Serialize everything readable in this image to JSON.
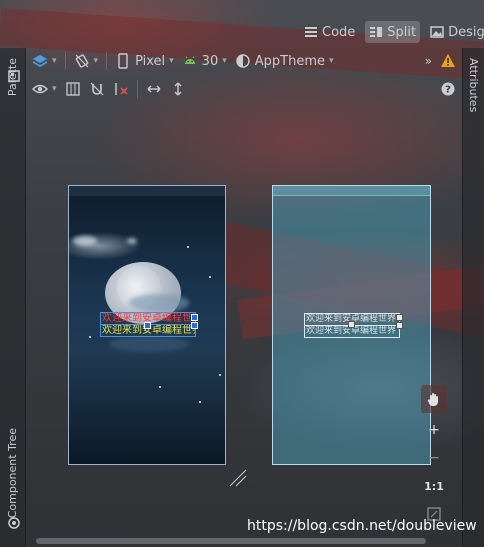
{
  "view_modes": [
    {
      "label": "Code",
      "icon": "code-lines-icon",
      "active": false
    },
    {
      "label": "Split",
      "icon": "split-view-icon",
      "active": true
    },
    {
      "label": "Design",
      "icon": "image-icon",
      "active": false
    }
  ],
  "sidebars": {
    "palette": "Palette",
    "component_tree": "Component Tree",
    "attributes": "Attributes"
  },
  "toolbar": {
    "device": "Pixel",
    "api_level": "30",
    "theme": "AppTheme"
  },
  "layout": {
    "text_view_1": "欢迎来到安卓编程世界",
    "text_view_2": "欢迎来到安卓编程世界"
  },
  "blueprint": {
    "text_view_1": "欢迎来到安卓编程世界",
    "text_view_2": "欢迎来到安卓编程世界"
  },
  "zoom": {
    "zoom_in": "+",
    "zoom_out": "−",
    "actual_size": "1:1"
  },
  "watermark": "https://blog.csdn.net/doubleview",
  "colors": {
    "text_view_1": "#ff3b3b",
    "text_view_2": "#e4e64a",
    "selection": "#2d6bd6",
    "warning": "#f0a30a",
    "api_android": "#78c257"
  }
}
